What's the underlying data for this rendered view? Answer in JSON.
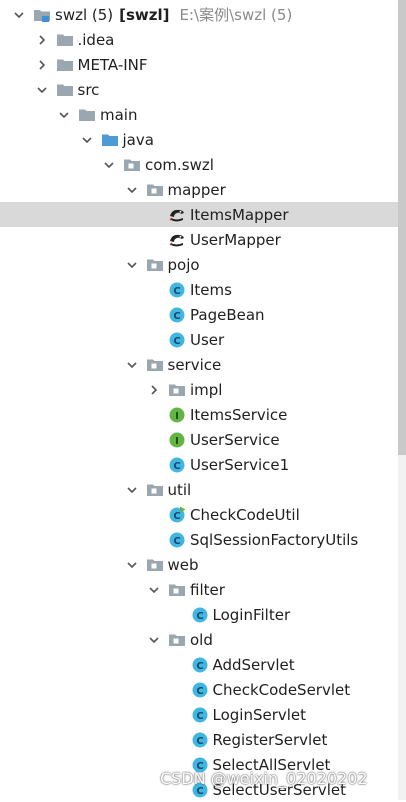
{
  "tree": [
    {
      "label": "swzl (5)",
      "bold": "[swzl]",
      "path": "E:\\案例\\swzl (5)",
      "icon": "module-folder-icon",
      "arrow": "down",
      "depth": 0,
      "name": "project-root"
    },
    {
      "label": ".idea",
      "icon": "folder-icon",
      "arrow": "right",
      "depth": 1,
      "name": "tree-item-idea"
    },
    {
      "label": "META-INF",
      "icon": "folder-icon",
      "arrow": "right",
      "depth": 1,
      "name": "tree-item-meta-inf"
    },
    {
      "label": "src",
      "icon": "folder-icon",
      "arrow": "down",
      "depth": 1,
      "name": "tree-item-src"
    },
    {
      "label": "main",
      "icon": "folder-icon",
      "arrow": "down",
      "depth": 2,
      "name": "tree-item-main"
    },
    {
      "label": "java",
      "icon": "source-folder-icon",
      "arrow": "down",
      "depth": 3,
      "name": "tree-item-java"
    },
    {
      "label": "com.swzl",
      "icon": "package-icon",
      "arrow": "down",
      "depth": 4,
      "name": "tree-item-com-swzl"
    },
    {
      "label": "mapper",
      "icon": "package-icon",
      "arrow": "down",
      "depth": 5,
      "name": "tree-item-mapper"
    },
    {
      "label": "ItemsMapper",
      "icon": "mybatis-bird-icon",
      "arrow": "none",
      "depth": 6,
      "selected": true,
      "name": "tree-item-itemsmapper"
    },
    {
      "label": "UserMapper",
      "icon": "mybatis-bird-icon",
      "arrow": "none",
      "depth": 6,
      "name": "tree-item-usermapper"
    },
    {
      "label": "pojo",
      "icon": "package-icon",
      "arrow": "down",
      "depth": 5,
      "name": "tree-item-pojo"
    },
    {
      "label": "Items",
      "icon": "class-icon",
      "arrow": "none",
      "depth": 6,
      "name": "tree-item-items"
    },
    {
      "label": "PageBean",
      "icon": "class-icon",
      "arrow": "none",
      "depth": 6,
      "name": "tree-item-pagebean"
    },
    {
      "label": "User",
      "icon": "class-icon",
      "arrow": "none",
      "depth": 6,
      "name": "tree-item-user"
    },
    {
      "label": "service",
      "icon": "package-icon",
      "arrow": "down",
      "depth": 5,
      "name": "tree-item-service"
    },
    {
      "label": "impl",
      "icon": "package-icon",
      "arrow": "right",
      "depth": 6,
      "name": "tree-item-impl"
    },
    {
      "label": "ItemsService",
      "icon": "interface-icon",
      "arrow": "none",
      "depth": 6,
      "name": "tree-item-itemsservice"
    },
    {
      "label": "UserService",
      "icon": "interface-icon",
      "arrow": "none",
      "depth": 6,
      "name": "tree-item-userservice"
    },
    {
      "label": "UserService1",
      "icon": "class-icon",
      "arrow": "none",
      "depth": 6,
      "name": "tree-item-userservice1"
    },
    {
      "label": "util",
      "icon": "package-icon",
      "arrow": "down",
      "depth": 5,
      "name": "tree-item-util"
    },
    {
      "label": "CheckCodeUtil",
      "icon": "runnable-class-icon",
      "arrow": "none",
      "depth": 6,
      "name": "tree-item-checkcodeutil"
    },
    {
      "label": "SqlSessionFactoryUtils",
      "icon": "class-icon",
      "arrow": "none",
      "depth": 6,
      "name": "tree-item-sqlsessionfactoryutils"
    },
    {
      "label": "web",
      "icon": "package-icon",
      "arrow": "down",
      "depth": 5,
      "name": "tree-item-web"
    },
    {
      "label": "filter",
      "icon": "package-icon",
      "arrow": "down",
      "depth": 6,
      "name": "tree-item-filter"
    },
    {
      "label": "LoginFilter",
      "icon": "class-icon",
      "arrow": "none",
      "depth": 7,
      "name": "tree-item-loginfilter"
    },
    {
      "label": "old",
      "icon": "package-icon",
      "arrow": "down",
      "depth": 6,
      "name": "tree-item-old"
    },
    {
      "label": "AddServlet",
      "icon": "class-icon",
      "arrow": "none",
      "depth": 7,
      "name": "tree-item-addservlet"
    },
    {
      "label": "CheckCodeServlet",
      "icon": "class-icon",
      "arrow": "none",
      "depth": 7,
      "name": "tree-item-checkcodeservlet"
    },
    {
      "label": "LoginServlet",
      "icon": "class-icon",
      "arrow": "none",
      "depth": 7,
      "name": "tree-item-loginservlet"
    },
    {
      "label": "RegisterServlet",
      "icon": "class-icon",
      "arrow": "none",
      "depth": 7,
      "name": "tree-item-registerservlet"
    },
    {
      "label": "SelectAllServlet",
      "icon": "class-icon",
      "arrow": "none",
      "depth": 7,
      "name": "tree-item-selectallservlet"
    },
    {
      "label": "SelectUserServlet",
      "icon": "class-icon",
      "arrow": "none",
      "depth": 7,
      "name": "tree-item-selectuserservlet"
    }
  ],
  "watermark": "CSDN @weixin_02020202",
  "colors": {
    "folder": "#9aa7b0",
    "class": "#40b6e0",
    "interface": "#62b543",
    "selection": "#d9d9d9"
  }
}
